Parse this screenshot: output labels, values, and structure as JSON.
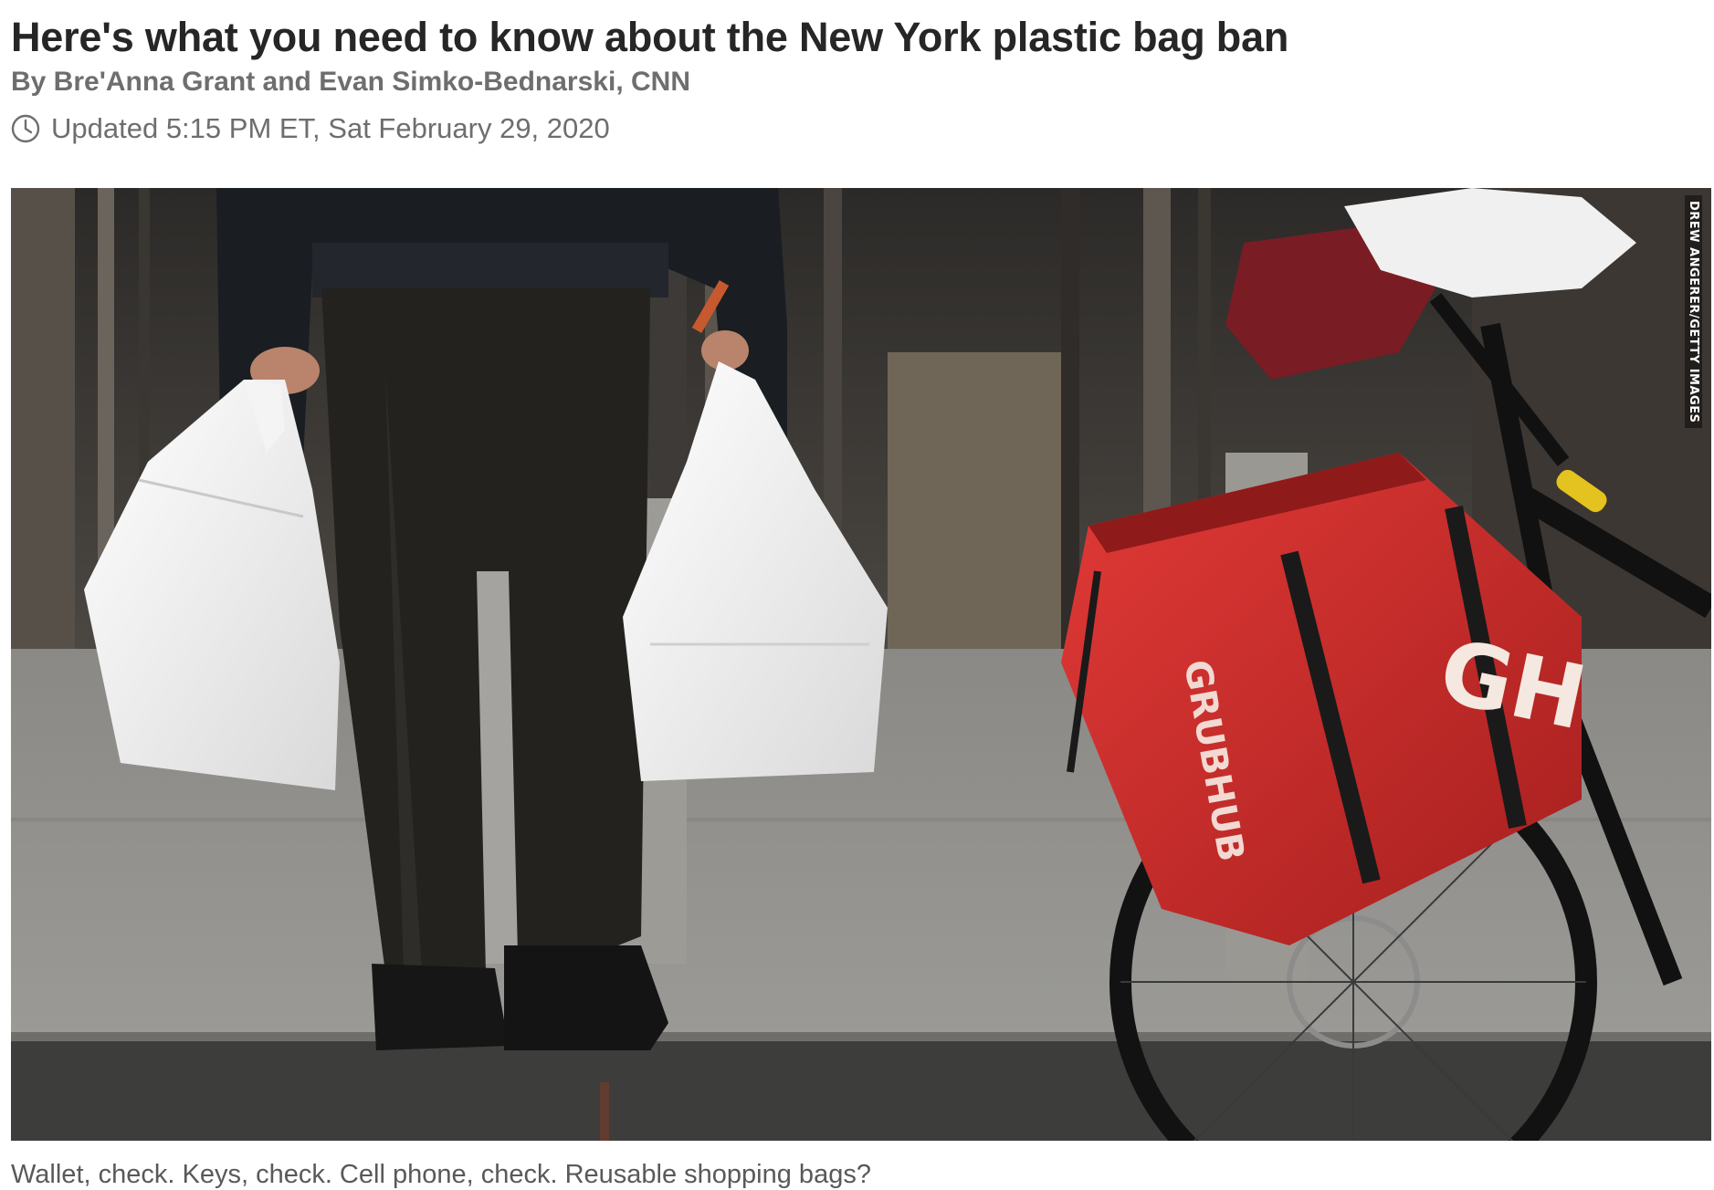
{
  "article": {
    "headline": "Here's what you need to know about the New York plastic bag ban",
    "byline": "By Bre'Anna Grant and Evan Simko-Bednarski, CNN",
    "updated": "Updated 5:15 PM ET, Sat February 29, 2020"
  },
  "media": {
    "credit": "DREW ANGERER/GETTY IMAGES",
    "bag_logo_text": "GH",
    "bag_brand_text": "GRUBHUB",
    "caption": "Wallet, check. Keys, check. Cell phone, check. Reusable shopping bags?"
  },
  "icons": {
    "timestamp_icon": "clock-icon"
  },
  "colors": {
    "headline": "#262626",
    "meta": "#6e6e6e",
    "caption": "#595959",
    "grubhub_red": "#d3302e"
  }
}
